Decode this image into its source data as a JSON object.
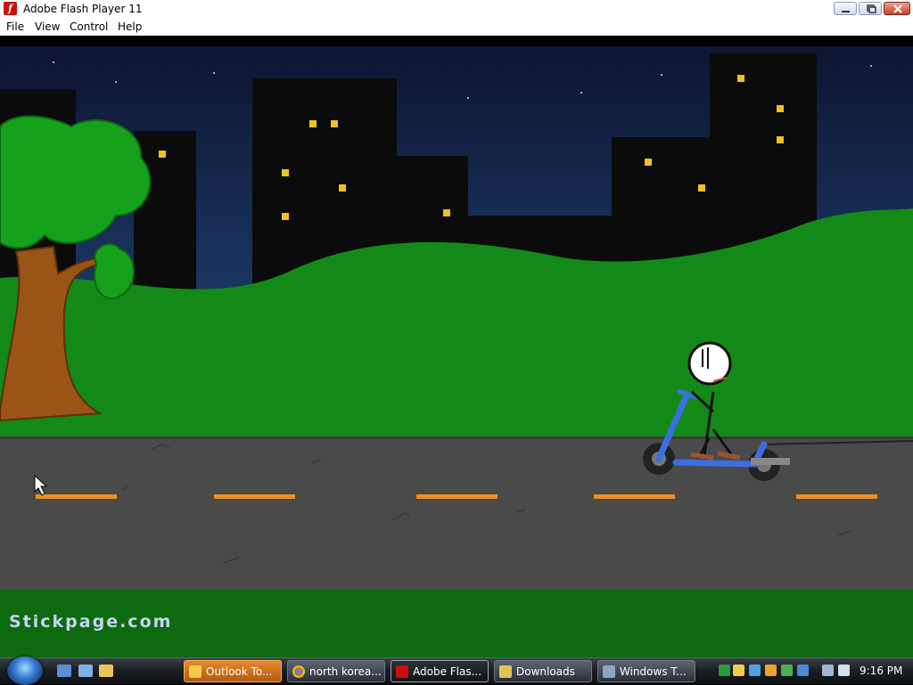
{
  "window": {
    "title": "Adobe Flash Player 11",
    "icon": "flash-icon",
    "controls": [
      "minimize-icon",
      "maximize-icon",
      "close-icon"
    ]
  },
  "menu": {
    "items": [
      "File",
      "View",
      "Control",
      "Help"
    ]
  },
  "game": {
    "watermark": "Stickpage.com",
    "scene": "night city street, stickman riding a blue scooter"
  },
  "taskbar": {
    "start_icon": "windows-start-icon",
    "quicklaunch": [
      "show-desktop-icon",
      "switch-windows-icon",
      "outlook-icon"
    ],
    "tasks": [
      {
        "label": "Outlook To...",
        "icon": "outlook-icon",
        "state": "flash"
      },
      {
        "label": "north korea...",
        "icon": "chrome-icon",
        "state": "normal"
      },
      {
        "label": "Adobe Flas...",
        "icon": "flash-icon",
        "state": "active"
      },
      {
        "label": "Downloads",
        "icon": "folder-icon",
        "state": "normal"
      },
      {
        "label": "Windows T...",
        "icon": "task-manager-icon",
        "state": "normal"
      }
    ],
    "tray_icons": [
      "green-app-icon",
      "outlook-tray-icon",
      "network-app-icon",
      "security-shield-icon",
      "check-icon",
      "update-icon",
      "network-icon",
      "volume-icon"
    ],
    "clock": "9:16 PM"
  }
}
